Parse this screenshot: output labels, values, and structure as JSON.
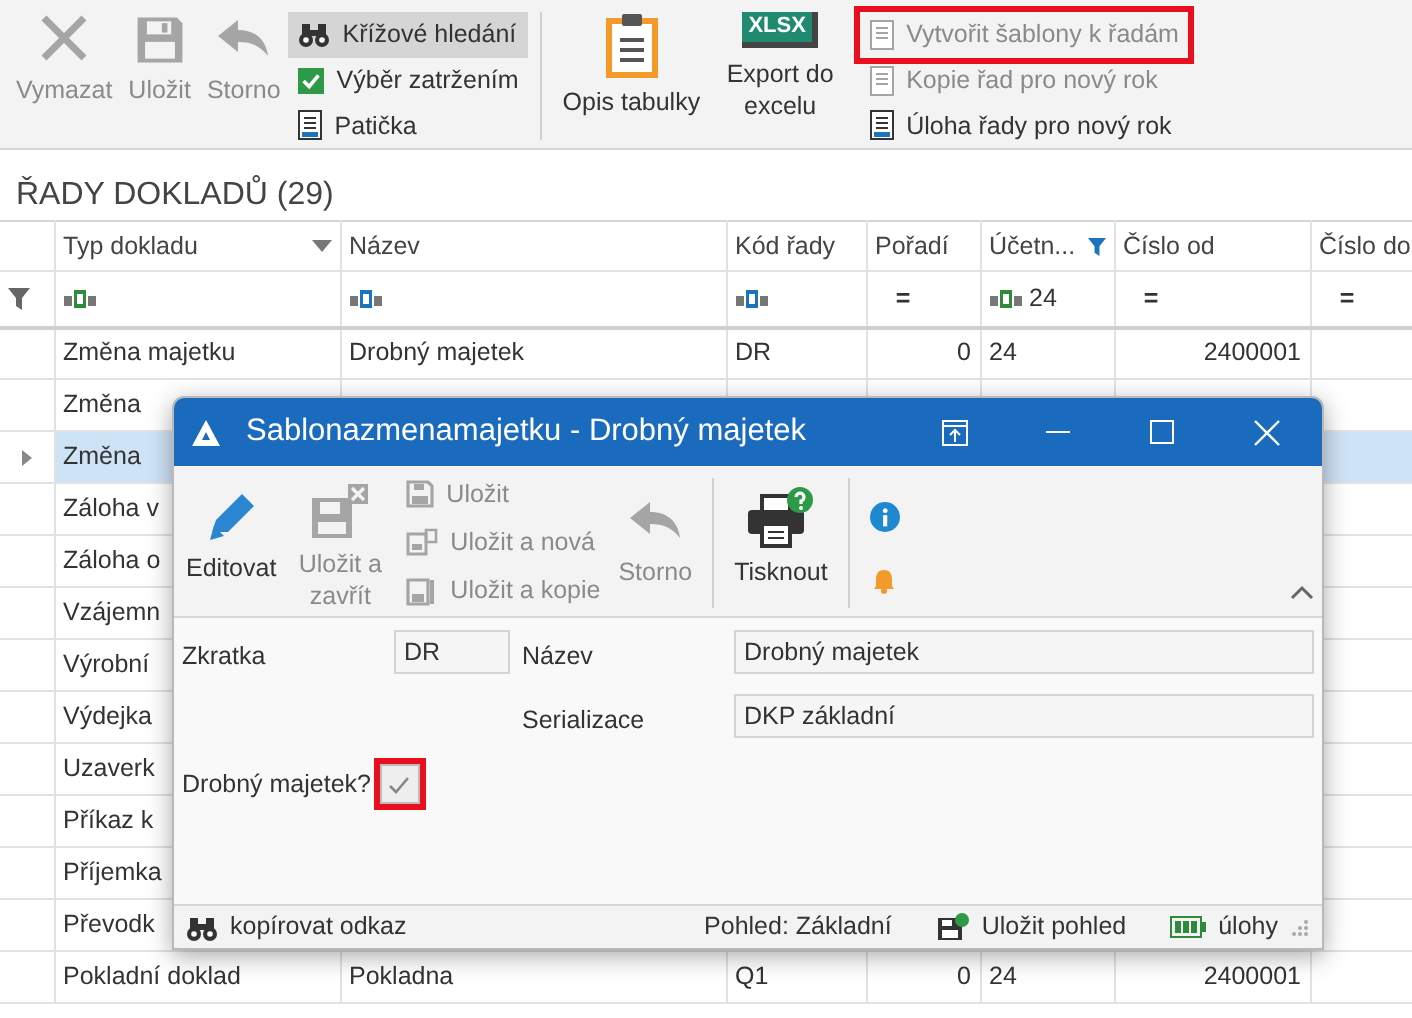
{
  "ribbon": {
    "large_buttons": [
      {
        "label": "Vymazat",
        "disabled": true
      },
      {
        "label": "Uložit",
        "disabled": true
      },
      {
        "label": "Storno",
        "disabled": true
      }
    ],
    "view_options": [
      {
        "label": "Křížové hledání",
        "selected": true
      },
      {
        "label": "Výběr zatržením",
        "selected": false
      },
      {
        "label": "Patička",
        "selected": false
      }
    ],
    "table_buttons": [
      {
        "label": "Opis tabulky"
      },
      {
        "label": "Export do excelu",
        "icon_text": "XLSX"
      }
    ],
    "row_actions": [
      {
        "label": "Vytvořit šablony k řadám",
        "disabled": true,
        "annotated": true
      },
      {
        "label": "Kopie řad pro nový rok",
        "disabled": true,
        "annotated": false
      },
      {
        "label": "Úloha řady pro nový rok",
        "disabled": false,
        "annotated": false
      }
    ]
  },
  "grid": {
    "title": "ŘADY DOKLADŮ (29)",
    "columns": [
      {
        "label": "Typ dokladu",
        "menu": true,
        "filtered": false
      },
      {
        "label": "Název",
        "menu": false,
        "filtered": false
      },
      {
        "label": "Kód řady",
        "menu": false,
        "filtered": false
      },
      {
        "label": "Pořadí",
        "menu": false,
        "filtered": false
      },
      {
        "label": "Účetn...",
        "menu": false,
        "filtered": true
      },
      {
        "label": "Číslo od",
        "menu": false,
        "filtered": false
      },
      {
        "label": "Číslo do",
        "menu": false,
        "filtered": false
      }
    ],
    "filter_row": [
      {
        "kind": "text",
        "color": "#2e8b3c"
      },
      {
        "kind": "text",
        "color": "#1e73be"
      },
      {
        "kind": "text",
        "color": "#1e73be"
      },
      {
        "kind": "operator",
        "text": "="
      },
      {
        "kind": "text",
        "color": "#2e8b3c",
        "text": "24"
      },
      {
        "kind": "operator",
        "text": "="
      },
      {
        "kind": "operator",
        "text": "="
      }
    ],
    "rows": [
      {
        "selected": false,
        "cells": [
          "Změna majetku",
          "Drobný majetek",
          "DR",
          "0",
          "24",
          "2400001"
        ]
      },
      {
        "selected": false,
        "cells": [
          "Změna"
        ]
      },
      {
        "selected": true,
        "cells": [
          "Změna"
        ]
      },
      {
        "selected": false,
        "cells": [
          "Záloha v"
        ]
      },
      {
        "selected": false,
        "cells": [
          "Záloha o"
        ]
      },
      {
        "selected": false,
        "cells": [
          "Vzájemn"
        ]
      },
      {
        "selected": false,
        "cells": [
          "Výrobní"
        ]
      },
      {
        "selected": false,
        "cells": [
          "Výdejka"
        ]
      },
      {
        "selected": false,
        "cells": [
          "Uzaverk"
        ]
      },
      {
        "selected": false,
        "cells": [
          "Příkaz k"
        ]
      },
      {
        "selected": false,
        "cells": [
          "Příjemka"
        ]
      },
      {
        "selected": false,
        "cells": [
          "Převodk"
        ]
      },
      {
        "selected": false,
        "cells": [
          "Pokladní doklad",
          "Pokladna",
          "Q1",
          "0",
          "24",
          "2400001"
        ]
      }
    ]
  },
  "dialog": {
    "title": "Sablonazmenamajetku - Drobný majetek",
    "toolbar": {
      "edit": {
        "label": "Editovat",
        "disabled": false
      },
      "save_close": {
        "label": "Uložit a zavřít",
        "disabled": true
      },
      "save_options": [
        {
          "label": "Uložit",
          "disabled": true
        },
        {
          "label": "Uložit a nová",
          "disabled": true
        },
        {
          "label": "Uložit a kopie",
          "disabled": true
        }
      ],
      "cancel": {
        "label": "Storno",
        "disabled": true
      },
      "print": {
        "label": "Tisknout",
        "disabled": false
      }
    },
    "fields": [
      {
        "label": "Zkratka",
        "value": "DR"
      },
      {
        "label": "Název",
        "value": "Drobný majetek"
      },
      {
        "label": "Serializace",
        "value": "DKP základní"
      }
    ],
    "checkbox": {
      "label": "Drobný majetek?",
      "checked": true,
      "disabled": true,
      "annotated": true
    },
    "status_bar": {
      "link": "kopírovat odkaz",
      "view": "Pohled: Základní",
      "save_view": "Uložit pohled",
      "tasks": "úlohy"
    }
  }
}
